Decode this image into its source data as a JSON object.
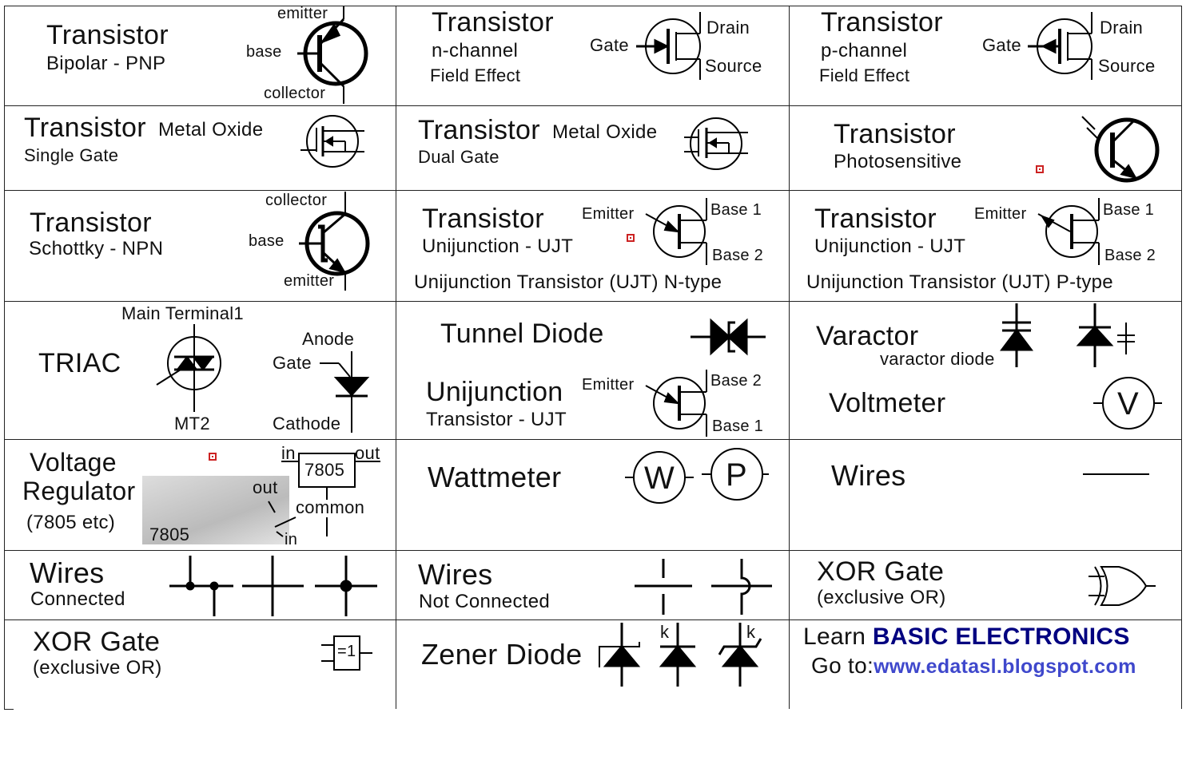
{
  "colors": {
    "brand": "#000080",
    "url": "#3f48cc",
    "marker": "#cc2222"
  },
  "cells": {
    "r1c1": {
      "title": "Transistor",
      "sub": "Bipolar  -  PNP",
      "emitter": "emitter",
      "base": "base",
      "collector": "collector"
    },
    "r1c2": {
      "title": "Transistor",
      "sub": "n-channel",
      "sub2": "Field Effect",
      "gate": "Gate",
      "drain": "Drain",
      "source": "Source"
    },
    "r1c3": {
      "title": "Transistor",
      "sub": "p-channel",
      "sub2": "Field Effect",
      "gate": "Gate",
      "drain": "Drain",
      "source": "Source"
    },
    "r2c1": {
      "title": "Transistor",
      "title2": "Metal Oxide",
      "sub": "Single Gate"
    },
    "r2c2": {
      "title": "Transistor",
      "title2": "Metal Oxide",
      "sub": "Dual Gate"
    },
    "r2c3": {
      "title": "Transistor",
      "sub": "Photosensitive"
    },
    "r3c1": {
      "title": "Transistor",
      "sub": "Schottky  -  NPN",
      "collector": "collector",
      "base": "base",
      "emitter": "emitter"
    },
    "r3c2": {
      "title": "Transistor",
      "sub": "Unijunction  -  UJT",
      "emitter": "Emitter",
      "base1": "Base 1",
      "base2": "Base 2",
      "caption": "Unijunction Transistor (UJT)  N-type"
    },
    "r3c3": {
      "title": "Transistor",
      "sub": "Unijunction  -  UJT",
      "emitter": "Emitter",
      "base1": "Base 1",
      "base2": "Base 2",
      "caption": "Unijunction Transistor (UJT)  P-type"
    },
    "r4c1": {
      "title": "TRIAC",
      "mt1": "Main Terminal1",
      "mt2": "MT2",
      "anode": "Anode",
      "gate": "Gate",
      "cathode": "Cathode"
    },
    "r4c2": {
      "title": "Tunnel Diode",
      "title2": "Unijunction",
      "sub": "Transistor - UJT",
      "emitter": "Emitter",
      "base2": "Base 2",
      "base1": "Base 1"
    },
    "r4c3": {
      "title": "Varactor",
      "sub": "varactor diode",
      "title2": "Voltmeter",
      "meter": "V"
    },
    "r5c1": {
      "title": "Voltage",
      "title2": "Regulator",
      "sub": "(7805 etc)",
      "photo_label": "7805",
      "photo_out": "out",
      "photo_in": "in",
      "in": "in",
      "out": "out",
      "chip": "7805",
      "common": "common"
    },
    "r5c2": {
      "title": "Wattmeter",
      "meter1": "W",
      "meter2": "P"
    },
    "r5c3": {
      "title": "Wires"
    },
    "r6c1": {
      "title": "Wires",
      "sub": "Connected"
    },
    "r6c2": {
      "title": "Wires",
      "sub": "Not Connected"
    },
    "r6c3": {
      "title": "XOR Gate",
      "sub": "(exclusive OR)"
    },
    "r7c1": {
      "title": "XOR Gate",
      "sub": "(exclusive OR)",
      "gate_label": "=1"
    },
    "r7c2": {
      "title": "Zener Diode",
      "k1": "k",
      "k2": "k"
    },
    "r7c3": {
      "learn": "Learn ",
      "brand": "BASIC ELECTRONICS",
      "goto": "Go to:",
      "url": "www.edatasl.blogspot.com"
    }
  }
}
